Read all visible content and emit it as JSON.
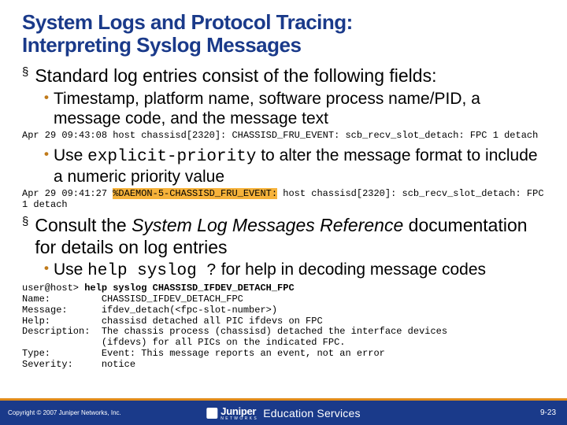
{
  "title_l1": "System Logs and Protocol Tracing:",
  "title_l2": "Interpreting Syslog Messages",
  "b1": "Standard log entries consist of the following fields:",
  "b1_1": "Timestamp, platform name, software process name/PID, a message code, and the message text",
  "log1": "Apr 29 09:43:08 host chassisd[2320]: CHASSISD_FRU_EVENT: scb_recv_slot_detach: FPC 1 detach",
  "b1_2a": "Use ",
  "b1_2code": "explicit-priority",
  "b1_2b": " to alter the message format to include a numeric priority value",
  "log2a": "Apr 29 09:41:27 ",
  "log2hl": "%DAEMON-5-CHASSISD_FRU_EVENT:",
  "log2b": " host chassisd[2320]: scb_recv_slot_detach: FPC 1 detach",
  "b2a": "Consult the ",
  "b2i": "System Log Messages Reference",
  "b2b": " documentation for details on log entries",
  "b2_1a": "Use ",
  "b2_1code": "help syslog ?",
  "b2_1b": " for help in decoding message codes",
  "ex_prompt": "user@host> ",
  "ex_cmd": "help syslog CHASSISD_IFDEV_DETACH_FPC",
  "ex_name": "Name:         CHASSISD_IFDEV_DETACH_FPC",
  "ex_msg": "Message:      ifdev_detach(<fpc-slot-number>)",
  "ex_help": "Help:         chassisd detached all PIC ifdevs on FPC",
  "ex_desc1": "Description:  The chassis process (chassisd) detached the interface devices",
  "ex_desc2": "              (ifdevs) for all PICs on the indicated FPC.",
  "ex_type": "Type:         Event: This message reports an event, not an error",
  "ex_sev": "Severity:     notice",
  "copyright": "Copyright © 2007 Juniper Networks, Inc.",
  "logo_name": "Juniper",
  "logo_sub": "N E T W O R K S",
  "edu": "Education Services",
  "pagenum": "9-23"
}
